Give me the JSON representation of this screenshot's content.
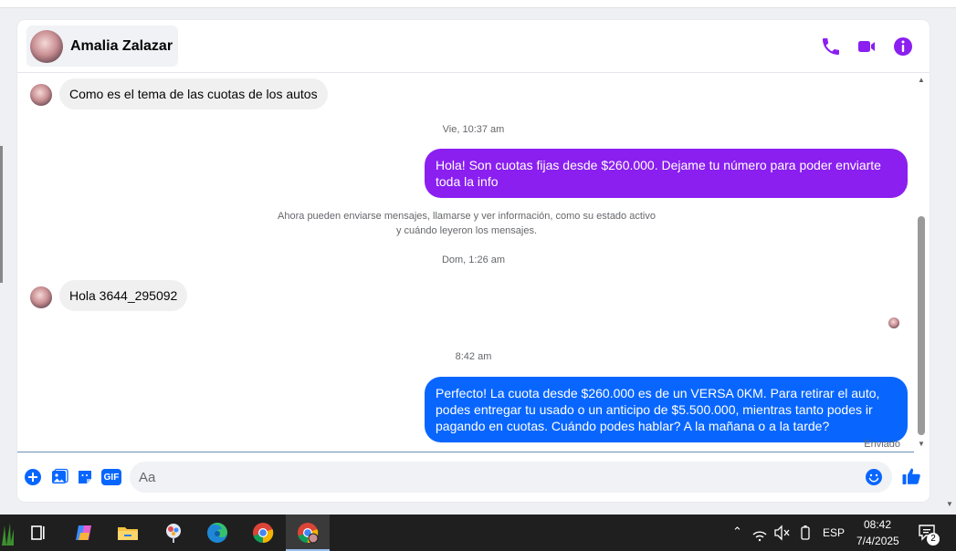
{
  "chat": {
    "contact_name": "Amalia Zalazar",
    "messages": {
      "m1": "Como es el tema de las cuotas de los autos",
      "t1": "Vie, 10:37 am",
      "m2": "Hola! Son cuotas fijas desde $260.000. Dejame tu número para poder enviarte toda la info",
      "notice_line1": "Ahora pueden enviarse mensajes, llamarse y ver información, como su estado activo",
      "notice_line2": "y cuándo leyeron los mensajes.",
      "t2": "Dom, 1:26 am",
      "m3": "Hola 3644_295092",
      "t3": "8:42 am",
      "m4": "Perfecto! La cuota desde $260.000 es de un VERSA 0KM. Para retirar el auto, podes entregar tu usado o un anticipo de $5.500.000, mientras tanto podes ir pagando en cuotas. Cuándo podes hablar? A la mañana o a la tarde?",
      "status": "Enviado"
    },
    "composer": {
      "placeholder": "Aa",
      "gif_label": "GIF"
    },
    "colors": {
      "accent": "#8a1ff0",
      "out_purple": "#8a1ff0",
      "out_blue": "#0866ff"
    }
  },
  "taskbar": {
    "language": "ESP",
    "time": "08:42",
    "date": "7/4/2025",
    "notifications": "2"
  }
}
